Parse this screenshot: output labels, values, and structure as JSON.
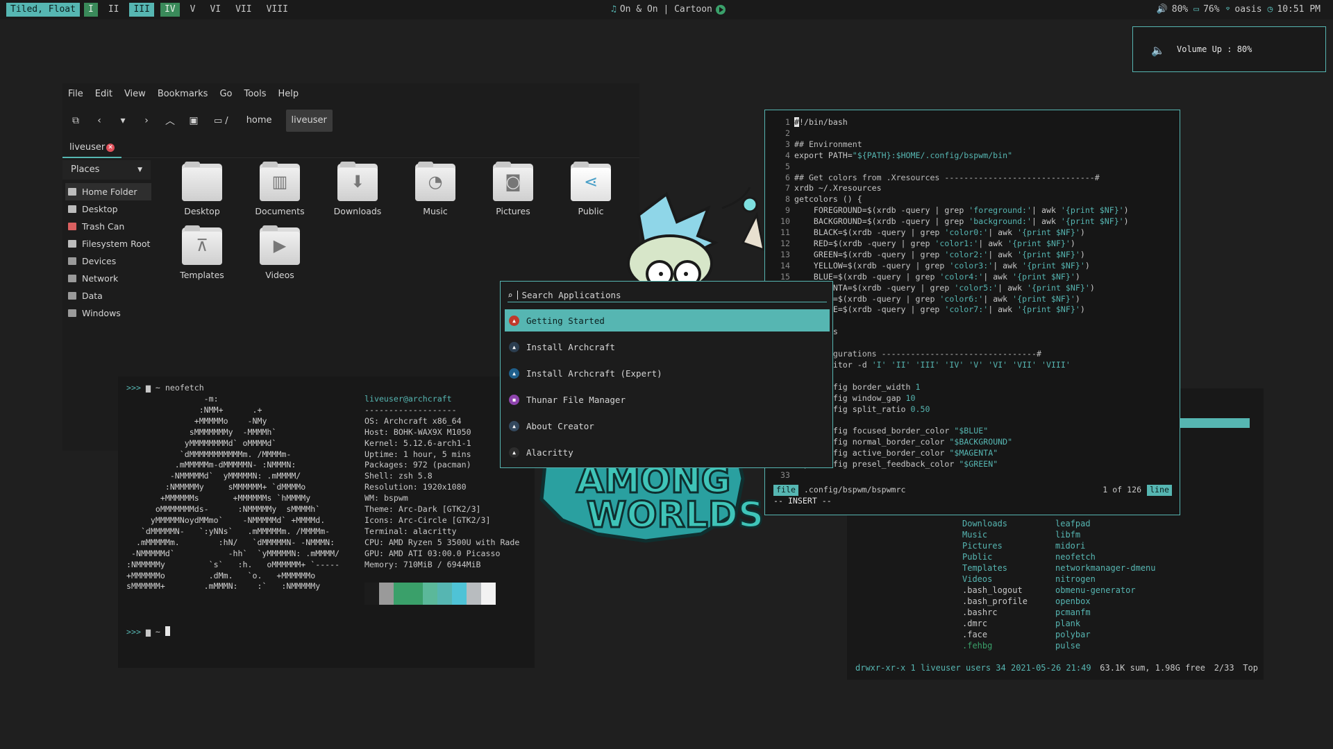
{
  "bar": {
    "mode": "Tiled, Float",
    "workspaces": [
      "I",
      "II",
      "III",
      "IV",
      "V",
      "VI",
      "VII",
      "VIII"
    ],
    "music": "On & On | Cartoon",
    "volume": "80%",
    "battery": "76%",
    "wifi": "oasis",
    "time": "10:51 PM"
  },
  "notification": {
    "text": "Volume Up : 80%"
  },
  "file_manager": {
    "menu": [
      "File",
      "Edit",
      "View",
      "Bookmarks",
      "Go",
      "Tools",
      "Help"
    ],
    "breadcrumb": {
      "root": "/",
      "items": [
        "home",
        "liveuser"
      ]
    },
    "tab": "liveuser",
    "places_title": "Places",
    "places": [
      "Home Folder",
      "Desktop",
      "Trash Can",
      "Filesystem Root",
      "Devices",
      "Network",
      "Data",
      "Windows"
    ],
    "files": [
      "Desktop",
      "Documents",
      "Downloads",
      "Music",
      "Pictures",
      "Public",
      "Templates",
      "Videos"
    ]
  },
  "neofetch": {
    "prompt_symbol": ">>>",
    "prompt_dir": "~",
    "command": "neofetch",
    "user_host": "liveuser@archcraft",
    "separator": "-------------------",
    "info": [
      [
        "OS:",
        "Archcraft x86_64"
      ],
      [
        "Host:",
        "BOHK-WAX9X M1050"
      ],
      [
        "Kernel:",
        "5.12.6-arch1-1"
      ],
      [
        "Uptime:",
        "1 hour, 5 mins"
      ],
      [
        "Packages:",
        "972 (pacman)"
      ],
      [
        "Shell:",
        "zsh 5.8"
      ],
      [
        "Resolution:",
        "1920x1080"
      ],
      [
        "WM:",
        "bspwm"
      ],
      [
        "Theme:",
        "Arc-Dark [GTK2/3]"
      ],
      [
        "Icons:",
        "Arc-Circle [GTK2/3]"
      ],
      [
        "Terminal:",
        "alacritty"
      ],
      [
        "CPU:",
        "AMD Ryzen 5 3500U with Rade"
      ],
      [
        "GPU:",
        "AMD ATI 03:00.0 Picasso"
      ],
      [
        "Memory:",
        "710MiB / 6944MiB"
      ]
    ],
    "palette": [
      "#1c1c1c",
      "#9a9a9a",
      "#3aa06a",
      "#3aa06a",
      "#5bb89a",
      "#56b6b2",
      "#4fc3d6",
      "#b8bcbf",
      "#f2f2f2"
    ]
  },
  "file_list": {
    "col1": [
      "Downloads",
      "Music",
      "Pictures",
      "Public",
      "Templates",
      "Videos",
      ".bash_logout",
      ".bash_profile",
      ".bashrc",
      ".dmrc",
      ".face",
      ".fehbg"
    ],
    "col2": [
      "leafpad",
      "libfm",
      "midori",
      "neofetch",
      "networkmanager-dmenu",
      "nitrogen",
      "obmenu-generator",
      "openbox",
      "pcmanfm",
      "plank",
      "polybar",
      "pulse"
    ],
    "footer_left": "drwxr-xr-x 1 liveuser users 34 2021-05-26 21:49",
    "footer_mid": "63.1K sum, 1.98G free",
    "footer_pos": "2/33",
    "footer_right": "Top"
  },
  "vim": {
    "file_tag": "file",
    "file_path": ".config/bspwm/bspwmrc",
    "position": "1 of 126",
    "pos_tag": "line",
    "mode": "-- INSERT --"
  },
  "rofi": {
    "placeholder": "Search Applications",
    "items": [
      "Getting Started",
      "Install Archcraft",
      "Install Archcraft (Expert)",
      "Thunar File Manager",
      "About Creator",
      "Alacritty"
    ]
  },
  "colors": {
    "accent": "#56b6b2",
    "green": "#3a8a5a",
    "background": "#1f1f1f"
  }
}
